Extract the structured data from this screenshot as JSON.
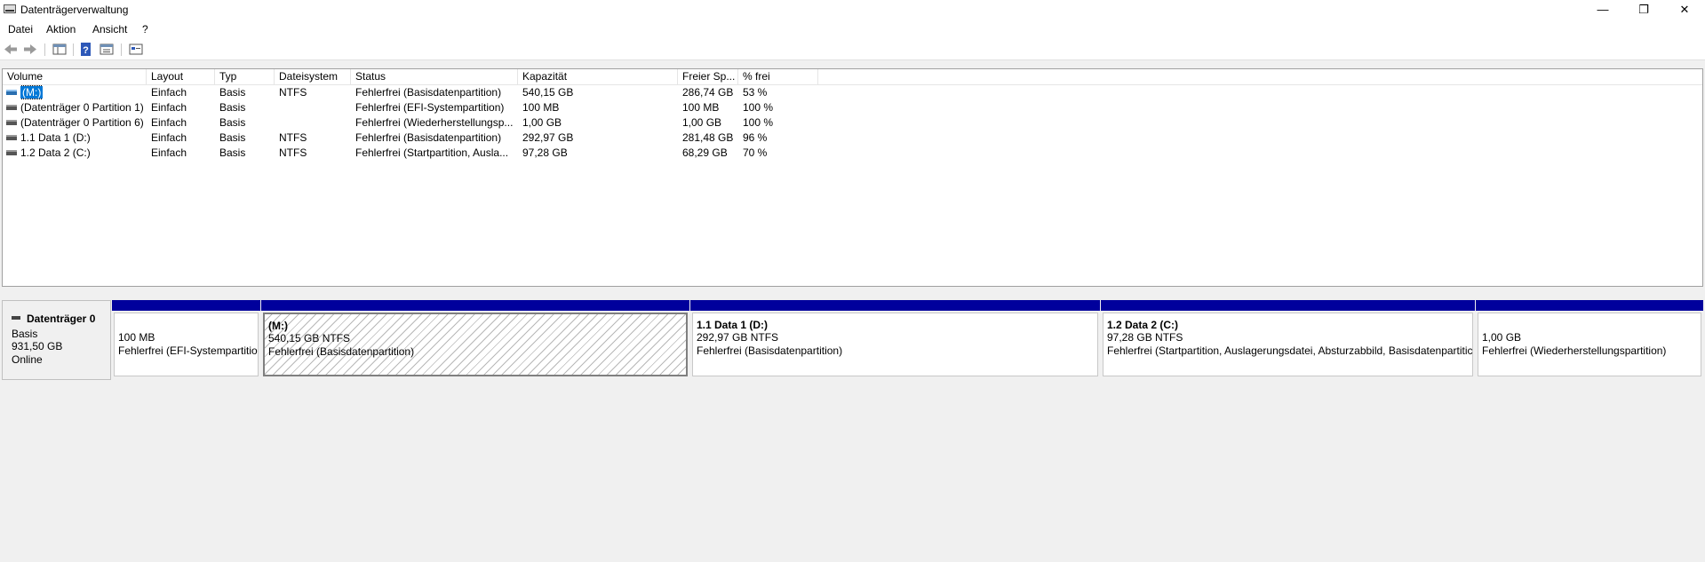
{
  "window": {
    "title": "Datenträgerverwaltung",
    "minimize": "—",
    "maximize": "❐",
    "close": "✕"
  },
  "menu": [
    "Datei",
    "Aktion",
    "Ansicht",
    "?"
  ],
  "toolbar": {
    "icons": [
      "back-icon",
      "forward-icon",
      "list-view-icon",
      "help-icon",
      "properties-icon",
      "disk-view-icon"
    ]
  },
  "columns": [
    "Volume",
    "Layout",
    "Typ",
    "Dateisystem",
    "Status",
    "Kapazität",
    "Freier Sp...",
    "% frei"
  ],
  "volumes": [
    {
      "volume": "(M:)",
      "layout": "Einfach",
      "typ": "Basis",
      "fs": "NTFS",
      "status": "Fehlerfrei (Basisdatenpartition)",
      "capacity": "540,15 GB",
      "free": "286,74 GB",
      "pct": "53 %"
    },
    {
      "volume": "(Datenträger 0 Partition 1)",
      "layout": "Einfach",
      "typ": "Basis",
      "fs": "",
      "status": "Fehlerfrei (EFI-Systempartition)",
      "capacity": "100 MB",
      "free": "100 MB",
      "pct": "100 %"
    },
    {
      "volume": "(Datenträger 0 Partition 6)",
      "layout": "Einfach",
      "typ": "Basis",
      "fs": "",
      "status": "Fehlerfrei (Wiederherstellungsp...",
      "capacity": "1,00 GB",
      "free": "1,00 GB",
      "pct": "100 %"
    },
    {
      "volume": "1.1 Data 1 (D:)",
      "layout": "Einfach",
      "typ": "Basis",
      "fs": "NTFS",
      "status": "Fehlerfrei (Basisdatenpartition)",
      "capacity": "292,97 GB",
      "free": "281,48 GB",
      "pct": "96 %"
    },
    {
      "volume": "1.2 Data 2 (C:)",
      "layout": "Einfach",
      "typ": "Basis",
      "fs": "NTFS",
      "status": "Fehlerfrei (Startpartition, Ausla...",
      "capacity": "97,28 GB",
      "free": "68,29 GB",
      "pct": "70 %"
    }
  ],
  "disk": {
    "name": "Datenträger 0",
    "type": "Basis",
    "size": "931,50 GB",
    "state": "Online"
  },
  "partitions": [
    {
      "label": "",
      "size": "100 MB",
      "status": "Fehlerfrei (EFI-Systempartitio"
    },
    {
      "label": "(M:)",
      "size": "540,15 GB NTFS",
      "status": "Fehlerfrei (Basisdatenpartition)"
    },
    {
      "label": "1.1 Data 1  (D:)",
      "size": "292,97 GB NTFS",
      "status": "Fehlerfrei (Basisdatenpartition)"
    },
    {
      "label": "1.2 Data 2  (C:)",
      "size": "97,28 GB NTFS",
      "status": "Fehlerfrei (Startpartition, Auslagerungsdatei, Absturzabbild, Basisdatenpartitic"
    },
    {
      "label": "",
      "size": "1,00 GB",
      "status": "Fehlerfrei (Wiederherstellungspartition)"
    }
  ],
  "colors": {
    "partition_bar": "#00009c",
    "selection": "#0078d7"
  }
}
